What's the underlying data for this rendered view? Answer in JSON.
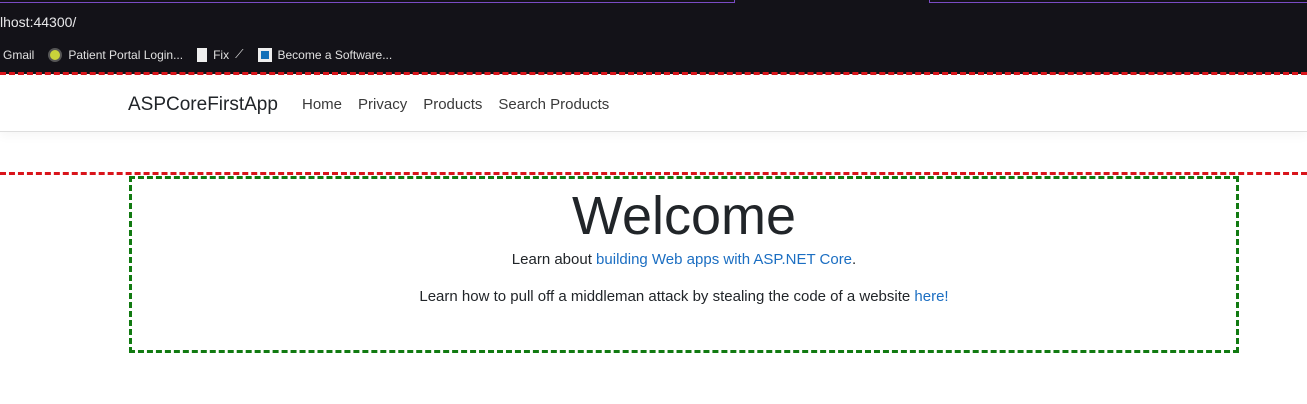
{
  "browser": {
    "url": "lhost:44300/",
    "bookmarks": [
      {
        "label": "Gmail",
        "icon": "gmail-icon"
      },
      {
        "label": "Patient Portal Login...",
        "icon": "portal-icon"
      },
      {
        "label": "Fix",
        "icon": "file-icon"
      },
      {
        "label": "Become a Software...",
        "icon": "video-icon"
      }
    ]
  },
  "nav": {
    "brand": "ASPCoreFirstApp",
    "links": [
      "Home",
      "Privacy",
      "Products",
      "Search Products"
    ]
  },
  "main": {
    "title": "Welcome",
    "line1_prefix": "Learn about ",
    "line1_link": "building Web apps with ASP.NET Core",
    "line1_suffix": ".",
    "line2_prefix": "Learn how to pull off a middleman attack by stealing the code of a website ",
    "line2_link": "here!"
  }
}
